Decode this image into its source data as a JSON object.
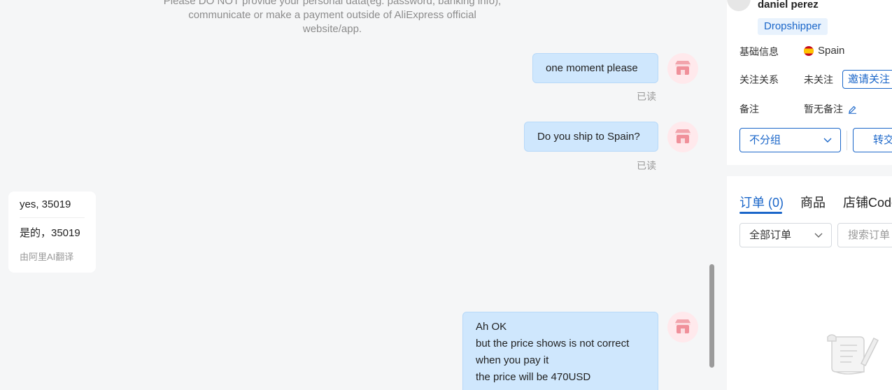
{
  "chat": {
    "notice": "Please DO NOT provide your personal data(eg. password, banking info), communicate or make a payment outside of AliExpress official website/app.",
    "messages": [
      {
        "text": "one moment please",
        "status": "已读"
      },
      {
        "text": "Do you ship to Spain?",
        "status": "已读"
      },
      {
        "text_lines": [
          "Ah  OK",
          "but the  price shows is not correct",
          "when you pay it",
          "the price will be 470USD"
        ]
      }
    ],
    "incoming": {
      "original": "yes, 35019",
      "translated": "是的，35019",
      "translator": "由阿里AI翻译"
    }
  },
  "panel": {
    "user_name": "daniel perez",
    "user_tag": "Dropshipper",
    "basic_info_label": "基础信息",
    "country": "Spain",
    "follow_label": "关注关系",
    "follow_status": "未关注",
    "invite_button": "邀请关注",
    "note_label": "备注",
    "note_value": "暂无备注",
    "group_select": "不分组",
    "transfer_button": "转交",
    "tabs": [
      {
        "label": "订单 (0)"
      },
      {
        "label": "商品"
      },
      {
        "label": "店铺Code"
      }
    ],
    "order_filter": "全部订单",
    "order_search_placeholder": "搜索订单"
  },
  "colors": {
    "accent": "#1a66c9",
    "bubble": "#cfe7fd",
    "avatar_bg": "#ffe9ec",
    "shop_icon": "#f0909a"
  }
}
